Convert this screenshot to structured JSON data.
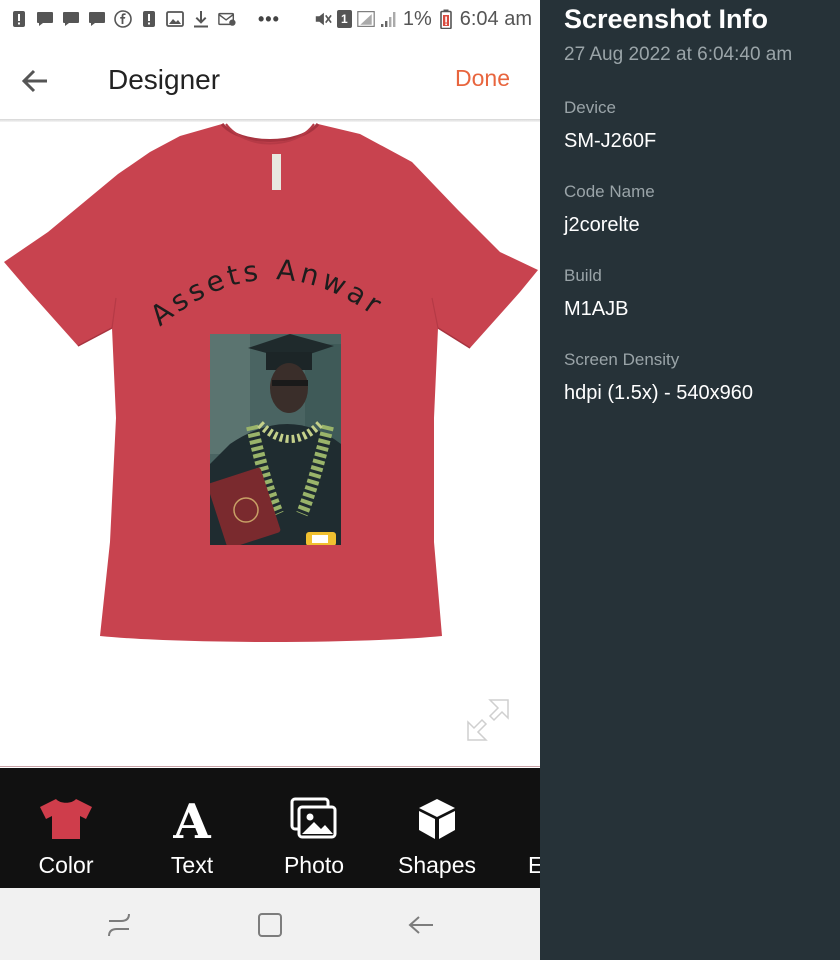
{
  "status_bar": {
    "battery_percent": "1%",
    "time": "6:04 am",
    "sim_badge": "1",
    "overflow": "•••"
  },
  "app_bar": {
    "title": "Designer",
    "done_label": "Done"
  },
  "design": {
    "shirt_color": "#c8434f",
    "curved_text": "Assets Anwar"
  },
  "toolbar": {
    "items": [
      {
        "label": "Color",
        "icon": "tshirt-icon"
      },
      {
        "label": "Text",
        "icon": "text-a-icon"
      },
      {
        "label": "Photo",
        "icon": "photo-icon"
      },
      {
        "label": "Shapes",
        "icon": "cube-icon"
      },
      {
        "label": "E",
        "icon": ""
      }
    ]
  },
  "info_panel": {
    "title": "Screenshot Info",
    "date": "27 Aug 2022 at 6:04:40 am",
    "fields": [
      {
        "label": "Device",
        "value": "SM-J260F"
      },
      {
        "label": "Code Name",
        "value": "j2corelte"
      },
      {
        "label": "Build",
        "value": "M1AJB"
      },
      {
        "label": "Screen Density",
        "value": "hdpi (1.5x) - 540x960"
      }
    ]
  },
  "colors": {
    "accent": "#e8653e",
    "panel_bg": "#263238",
    "toolbar_bg": "#111111"
  }
}
